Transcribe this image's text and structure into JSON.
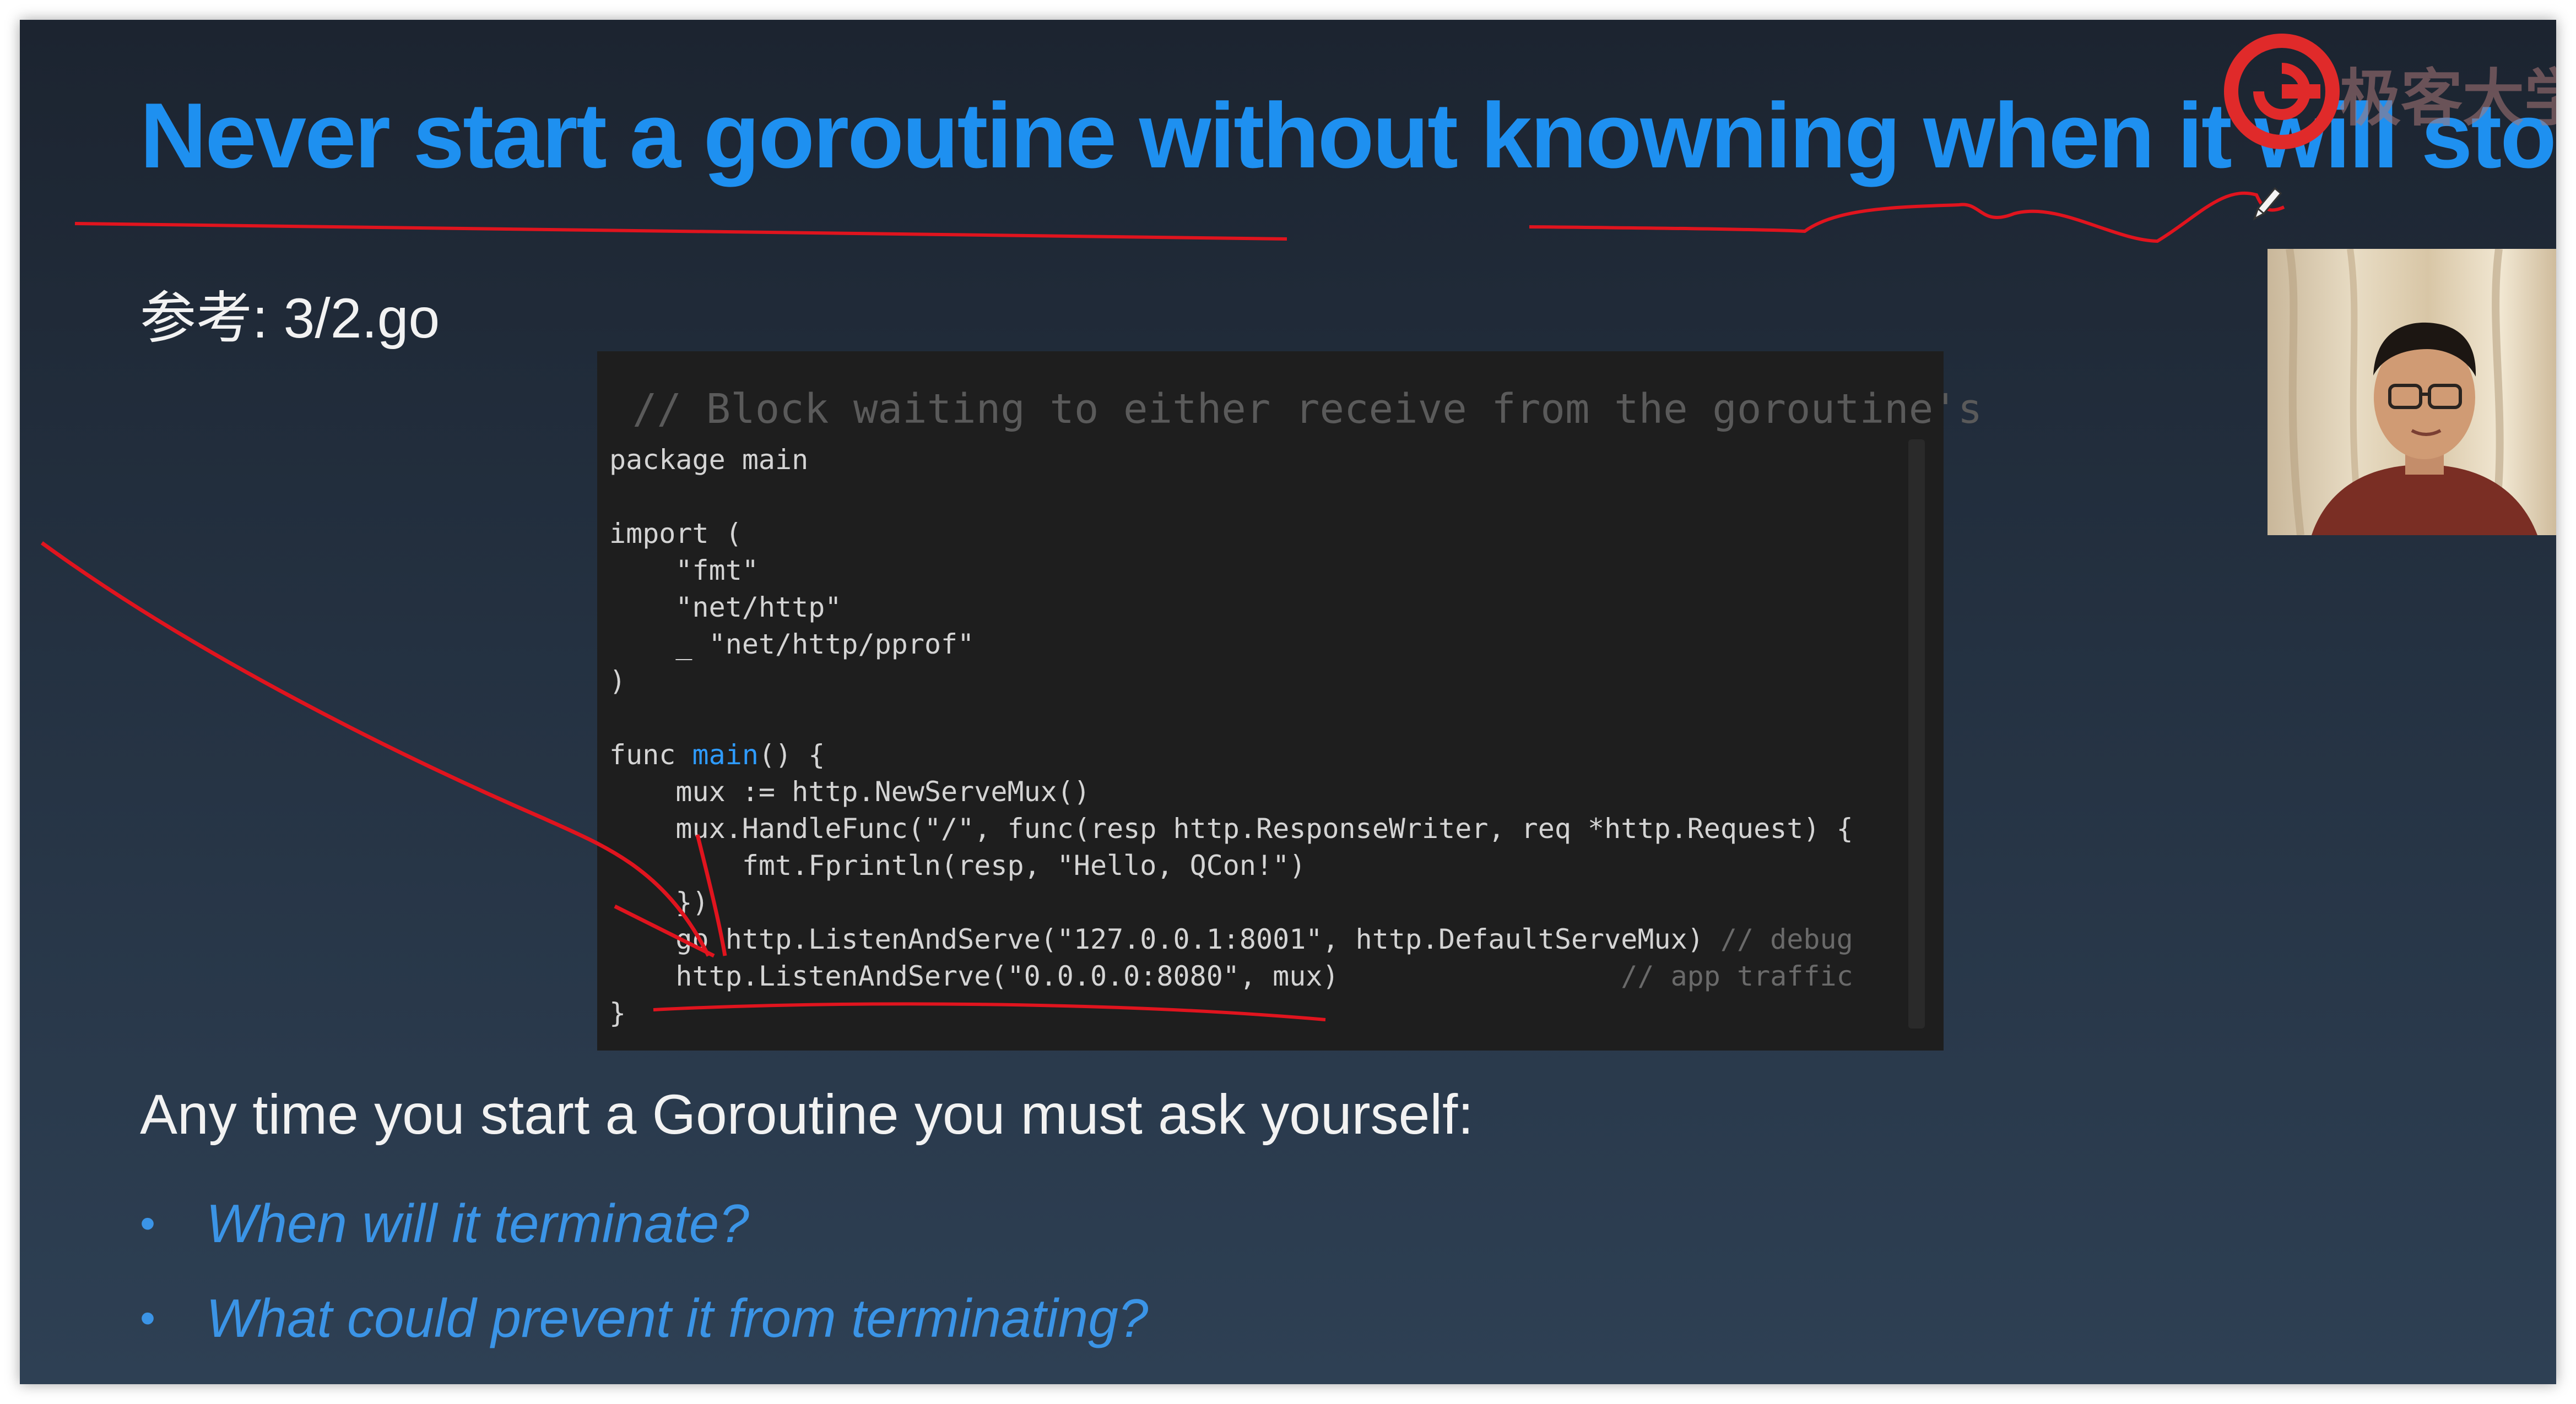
{
  "slide": {
    "title": "Never start a goroutine without knowning when it will stop",
    "reference": "参考: 3/2.go",
    "logo_text": "极客大学",
    "code": {
      "header_comment": "// Block waiting to either receive from the goroutine's",
      "lines": [
        [
          {
            "t": "package main"
          }
        ],
        [
          {
            "t": ""
          }
        ],
        [
          {
            "t": "import ("
          }
        ],
        [
          {
            "t": "    \"fmt\""
          }
        ],
        [
          {
            "t": "    \"net/http\""
          }
        ],
        [
          {
            "t": "    _ \"net/http/pprof\""
          }
        ],
        [
          {
            "t": ")"
          }
        ],
        [
          {
            "t": ""
          }
        ],
        [
          {
            "t": "func "
          },
          {
            "t": "main",
            "c": "kw"
          },
          {
            "t": "() {"
          }
        ],
        [
          {
            "t": "    mux := http.NewServeMux()"
          }
        ],
        [
          {
            "t": "    mux.HandleFunc(\"/\", func(resp http.ResponseWriter, req *http.Request) {"
          }
        ],
        [
          {
            "t": "        fmt.Fprintln(resp, \"Hello, QCon!\")"
          }
        ],
        [
          {
            "t": "    })"
          }
        ],
        [
          {
            "t": "    go http.ListenAndServe(\"127.0.0.1:8001\", http.DefaultServeMux) "
          },
          {
            "t": "// debug",
            "c": "cm"
          }
        ],
        [
          {
            "t": "    http.ListenAndServe(\"0.0.0.0:8080\", mux)                 "
          },
          {
            "t": "// app traffic",
            "c": "cm"
          }
        ],
        [
          {
            "t": "}"
          }
        ]
      ]
    },
    "lead": "Any time you start a Goroutine you must ask yourself:",
    "bullet_symbol": "•",
    "bullets": [
      "When will it terminate?",
      "What could prevent it from terminating?"
    ],
    "colors": {
      "title": "#1e90f0",
      "bullet": "#3b94e6",
      "annotation": "#e0141e",
      "keyword": "#2e9bff"
    },
    "icons": [
      "geekbang-logo-icon",
      "pen-cursor-icon",
      "webcam-presenter"
    ]
  }
}
